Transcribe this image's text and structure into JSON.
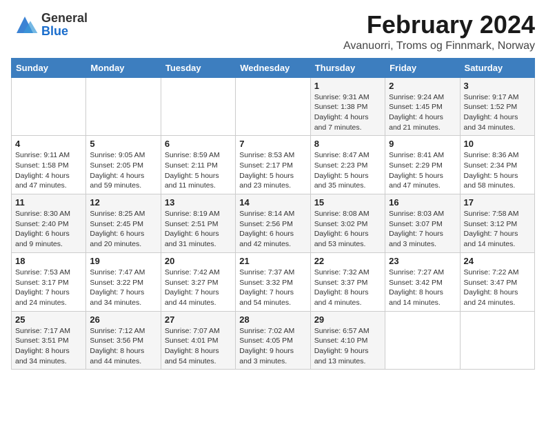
{
  "header": {
    "logo_general": "General",
    "logo_blue": "Blue",
    "title": "February 2024",
    "subtitle": "Avanuorri, Troms og Finnmark, Norway"
  },
  "weekdays": [
    "Sunday",
    "Monday",
    "Tuesday",
    "Wednesday",
    "Thursday",
    "Friday",
    "Saturday"
  ],
  "weeks": [
    [
      {
        "day": "",
        "sunrise": "",
        "sunset": "",
        "daylight": ""
      },
      {
        "day": "",
        "sunrise": "",
        "sunset": "",
        "daylight": ""
      },
      {
        "day": "",
        "sunrise": "",
        "sunset": "",
        "daylight": ""
      },
      {
        "day": "",
        "sunrise": "",
        "sunset": "",
        "daylight": ""
      },
      {
        "day": "1",
        "sunrise": "Sunrise: 9:31 AM",
        "sunset": "Sunset: 1:38 PM",
        "daylight": "Daylight: 4 hours and 7 minutes."
      },
      {
        "day": "2",
        "sunrise": "Sunrise: 9:24 AM",
        "sunset": "Sunset: 1:45 PM",
        "daylight": "Daylight: 4 hours and 21 minutes."
      },
      {
        "day": "3",
        "sunrise": "Sunrise: 9:17 AM",
        "sunset": "Sunset: 1:52 PM",
        "daylight": "Daylight: 4 hours and 34 minutes."
      }
    ],
    [
      {
        "day": "4",
        "sunrise": "Sunrise: 9:11 AM",
        "sunset": "Sunset: 1:58 PM",
        "daylight": "Daylight: 4 hours and 47 minutes."
      },
      {
        "day": "5",
        "sunrise": "Sunrise: 9:05 AM",
        "sunset": "Sunset: 2:05 PM",
        "daylight": "Daylight: 4 hours and 59 minutes."
      },
      {
        "day": "6",
        "sunrise": "Sunrise: 8:59 AM",
        "sunset": "Sunset: 2:11 PM",
        "daylight": "Daylight: 5 hours and 11 minutes."
      },
      {
        "day": "7",
        "sunrise": "Sunrise: 8:53 AM",
        "sunset": "Sunset: 2:17 PM",
        "daylight": "Daylight: 5 hours and 23 minutes."
      },
      {
        "day": "8",
        "sunrise": "Sunrise: 8:47 AM",
        "sunset": "Sunset: 2:23 PM",
        "daylight": "Daylight: 5 hours and 35 minutes."
      },
      {
        "day": "9",
        "sunrise": "Sunrise: 8:41 AM",
        "sunset": "Sunset: 2:29 PM",
        "daylight": "Daylight: 5 hours and 47 minutes."
      },
      {
        "day": "10",
        "sunrise": "Sunrise: 8:36 AM",
        "sunset": "Sunset: 2:34 PM",
        "daylight": "Daylight: 5 hours and 58 minutes."
      }
    ],
    [
      {
        "day": "11",
        "sunrise": "Sunrise: 8:30 AM",
        "sunset": "Sunset: 2:40 PM",
        "daylight": "Daylight: 6 hours and 9 minutes."
      },
      {
        "day": "12",
        "sunrise": "Sunrise: 8:25 AM",
        "sunset": "Sunset: 2:45 PM",
        "daylight": "Daylight: 6 hours and 20 minutes."
      },
      {
        "day": "13",
        "sunrise": "Sunrise: 8:19 AM",
        "sunset": "Sunset: 2:51 PM",
        "daylight": "Daylight: 6 hours and 31 minutes."
      },
      {
        "day": "14",
        "sunrise": "Sunrise: 8:14 AM",
        "sunset": "Sunset: 2:56 PM",
        "daylight": "Daylight: 6 hours and 42 minutes."
      },
      {
        "day": "15",
        "sunrise": "Sunrise: 8:08 AM",
        "sunset": "Sunset: 3:02 PM",
        "daylight": "Daylight: 6 hours and 53 minutes."
      },
      {
        "day": "16",
        "sunrise": "Sunrise: 8:03 AM",
        "sunset": "Sunset: 3:07 PM",
        "daylight": "Daylight: 7 hours and 3 minutes."
      },
      {
        "day": "17",
        "sunrise": "Sunrise: 7:58 AM",
        "sunset": "Sunset: 3:12 PM",
        "daylight": "Daylight: 7 hours and 14 minutes."
      }
    ],
    [
      {
        "day": "18",
        "sunrise": "Sunrise: 7:53 AM",
        "sunset": "Sunset: 3:17 PM",
        "daylight": "Daylight: 7 hours and 24 minutes."
      },
      {
        "day": "19",
        "sunrise": "Sunrise: 7:47 AM",
        "sunset": "Sunset: 3:22 PM",
        "daylight": "Daylight: 7 hours and 34 minutes."
      },
      {
        "day": "20",
        "sunrise": "Sunrise: 7:42 AM",
        "sunset": "Sunset: 3:27 PM",
        "daylight": "Daylight: 7 hours and 44 minutes."
      },
      {
        "day": "21",
        "sunrise": "Sunrise: 7:37 AM",
        "sunset": "Sunset: 3:32 PM",
        "daylight": "Daylight: 7 hours and 54 minutes."
      },
      {
        "day": "22",
        "sunrise": "Sunrise: 7:32 AM",
        "sunset": "Sunset: 3:37 PM",
        "daylight": "Daylight: 8 hours and 4 minutes."
      },
      {
        "day": "23",
        "sunrise": "Sunrise: 7:27 AM",
        "sunset": "Sunset: 3:42 PM",
        "daylight": "Daylight: 8 hours and 14 minutes."
      },
      {
        "day": "24",
        "sunrise": "Sunrise: 7:22 AM",
        "sunset": "Sunset: 3:47 PM",
        "daylight": "Daylight: 8 hours and 24 minutes."
      }
    ],
    [
      {
        "day": "25",
        "sunrise": "Sunrise: 7:17 AM",
        "sunset": "Sunset: 3:51 PM",
        "daylight": "Daylight: 8 hours and 34 minutes."
      },
      {
        "day": "26",
        "sunrise": "Sunrise: 7:12 AM",
        "sunset": "Sunset: 3:56 PM",
        "daylight": "Daylight: 8 hours and 44 minutes."
      },
      {
        "day": "27",
        "sunrise": "Sunrise: 7:07 AM",
        "sunset": "Sunset: 4:01 PM",
        "daylight": "Daylight: 8 hours and 54 minutes."
      },
      {
        "day": "28",
        "sunrise": "Sunrise: 7:02 AM",
        "sunset": "Sunset: 4:05 PM",
        "daylight": "Daylight: 9 hours and 3 minutes."
      },
      {
        "day": "29",
        "sunrise": "Sunrise: 6:57 AM",
        "sunset": "Sunset: 4:10 PM",
        "daylight": "Daylight: 9 hours and 13 minutes."
      },
      {
        "day": "",
        "sunrise": "",
        "sunset": "",
        "daylight": ""
      },
      {
        "day": "",
        "sunrise": "",
        "sunset": "",
        "daylight": ""
      }
    ]
  ]
}
